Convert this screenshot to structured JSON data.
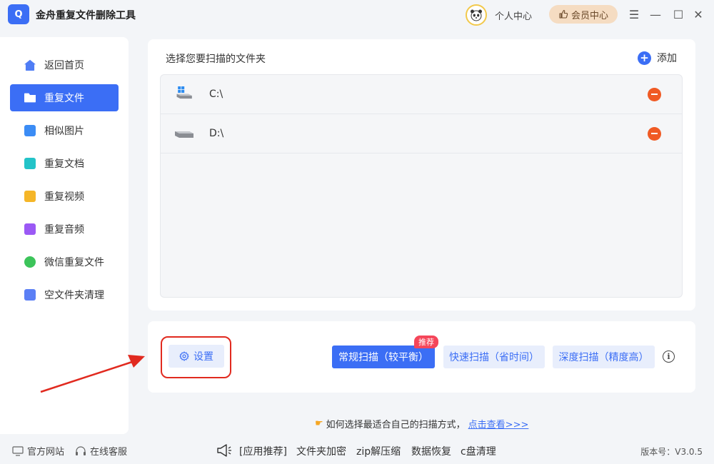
{
  "app": {
    "logo_text": "Q",
    "title": "金舟重复文件删除工具"
  },
  "header": {
    "user_center": "个人中心",
    "vip_center": "会员中心",
    "menu_icon": "☰",
    "minimize_icon": "—",
    "maximize_icon": "☐",
    "close_icon": "✕"
  },
  "sidebar": {
    "items": [
      {
        "label": "返回首页",
        "icon": "home-icon",
        "color": "#4f7df5"
      },
      {
        "label": "重复文件",
        "icon": "folder-icon",
        "color": "#ffffff"
      },
      {
        "label": "相似图片",
        "icon": "image-icon",
        "color": "#3b8cf5"
      },
      {
        "label": "重复文档",
        "icon": "document-icon",
        "color": "#23c3c8"
      },
      {
        "label": "重复视频",
        "icon": "video-icon",
        "color": "#f5b628"
      },
      {
        "label": "重复音频",
        "icon": "audio-icon",
        "color": "#9b59f5"
      },
      {
        "label": "微信重复文件",
        "icon": "wechat-icon",
        "color": "#3cc45a"
      },
      {
        "label": "空文件夹清理",
        "icon": "empty-folder-icon",
        "color": "#5b7ff5"
      }
    ]
  },
  "folder_panel": {
    "title": "选择您要扫描的文件夹",
    "add_label": "添加",
    "folders": [
      {
        "label": "C:\\"
      },
      {
        "label": "D:\\"
      }
    ]
  },
  "scan": {
    "settings_label": "设置",
    "recommend_badge": "推荐",
    "buttons": [
      {
        "label": "常规扫描（较平衡）"
      },
      {
        "label": "快速扫描（省时间）"
      },
      {
        "label": "深度扫描（精度高）"
      }
    ],
    "info_icon": "i"
  },
  "tip": {
    "text": "如何选择最适合自己的扫描方式，",
    "link": "点击查看>>>"
  },
  "footer": {
    "official_site": "官方网站",
    "online_service": "在线客服",
    "app_recommend": "[应用推荐]",
    "links": [
      "文件夹加密",
      "zip解压缩",
      "数据恢复",
      "c盘清理"
    ],
    "version": "版本号：V3.0.5"
  },
  "colors": {
    "accent": "#3b6ef5",
    "danger": "#f05a24",
    "annotation_red": "#e12a1f"
  }
}
